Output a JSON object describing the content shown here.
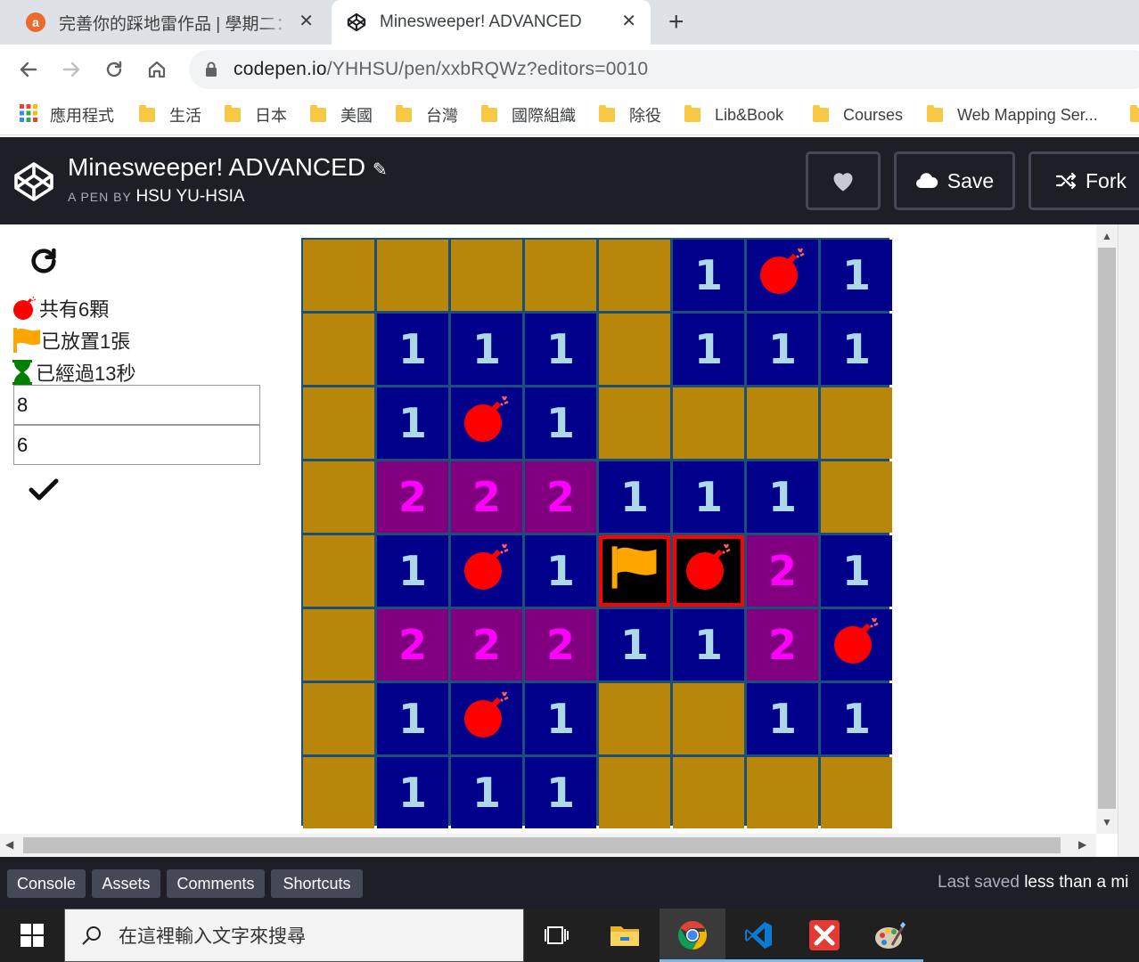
{
  "browser": {
    "tabs": [
      {
        "title": "完善你的踩地雷作品 | 學期二：Ja",
        "active": false
      },
      {
        "title": "Minesweeper! ADVANCED",
        "active": true
      }
    ],
    "url_host": "codepen.io",
    "url_path": "/YHHSU/pen/xxbRQWz?editors=0010",
    "bookmarks": [
      "應用程式",
      "生活",
      "日本",
      "美國",
      "台灣",
      "國際組織",
      "除役",
      "Lib&Book",
      "Courses",
      "Web Mapping Ser..."
    ]
  },
  "codepen": {
    "title": "Minesweeper! ADVANCED",
    "by_label": "A PEN BY",
    "author": "HSU YU-HSIA",
    "save_label": "Save",
    "fork_label": "Fork",
    "footer_tabs": [
      "Console",
      "Assets",
      "Comments",
      "Shortcuts"
    ],
    "last_saved_prefix": "Last saved",
    "last_saved_value": "less than a mi"
  },
  "game": {
    "mine_total_text": "共有6顆",
    "flags_placed_text": "已放置1張",
    "time_elapsed_text": "已經過13秒",
    "size_input": "8",
    "mines_input": "6",
    "board": [
      [
        "h",
        "h",
        "h",
        "h",
        "h",
        "1",
        "m",
        "1"
      ],
      [
        "h",
        "1",
        "1",
        "1",
        "h",
        "1",
        "1",
        "1"
      ],
      [
        "h",
        "1",
        "m",
        "1",
        "h",
        "h",
        "h",
        "h"
      ],
      [
        "h",
        "2",
        "2",
        "2",
        "1",
        "1",
        "1",
        "h"
      ],
      [
        "h",
        "1",
        "m",
        "1",
        "f",
        "x",
        "2",
        "1"
      ],
      [
        "h",
        "2",
        "2",
        "2",
        "1",
        "1",
        "2",
        "m"
      ],
      [
        "h",
        "1",
        "m",
        "1",
        "h",
        "h",
        "1",
        "1"
      ],
      [
        "h",
        "1",
        "1",
        "1",
        "h",
        "h",
        "h",
        "h"
      ]
    ]
  },
  "taskbar": {
    "search_placeholder": "在這裡輸入文字來搜尋"
  },
  "colors": {
    "hidden_cell": "#b8860b",
    "open_cell": "#00008b",
    "number_one": "#add8e6",
    "two_cell": "#800080",
    "number_two": "#ff00ff",
    "mine": "#ff0000",
    "flag": "#ffa500",
    "hourglass": "#008000"
  }
}
